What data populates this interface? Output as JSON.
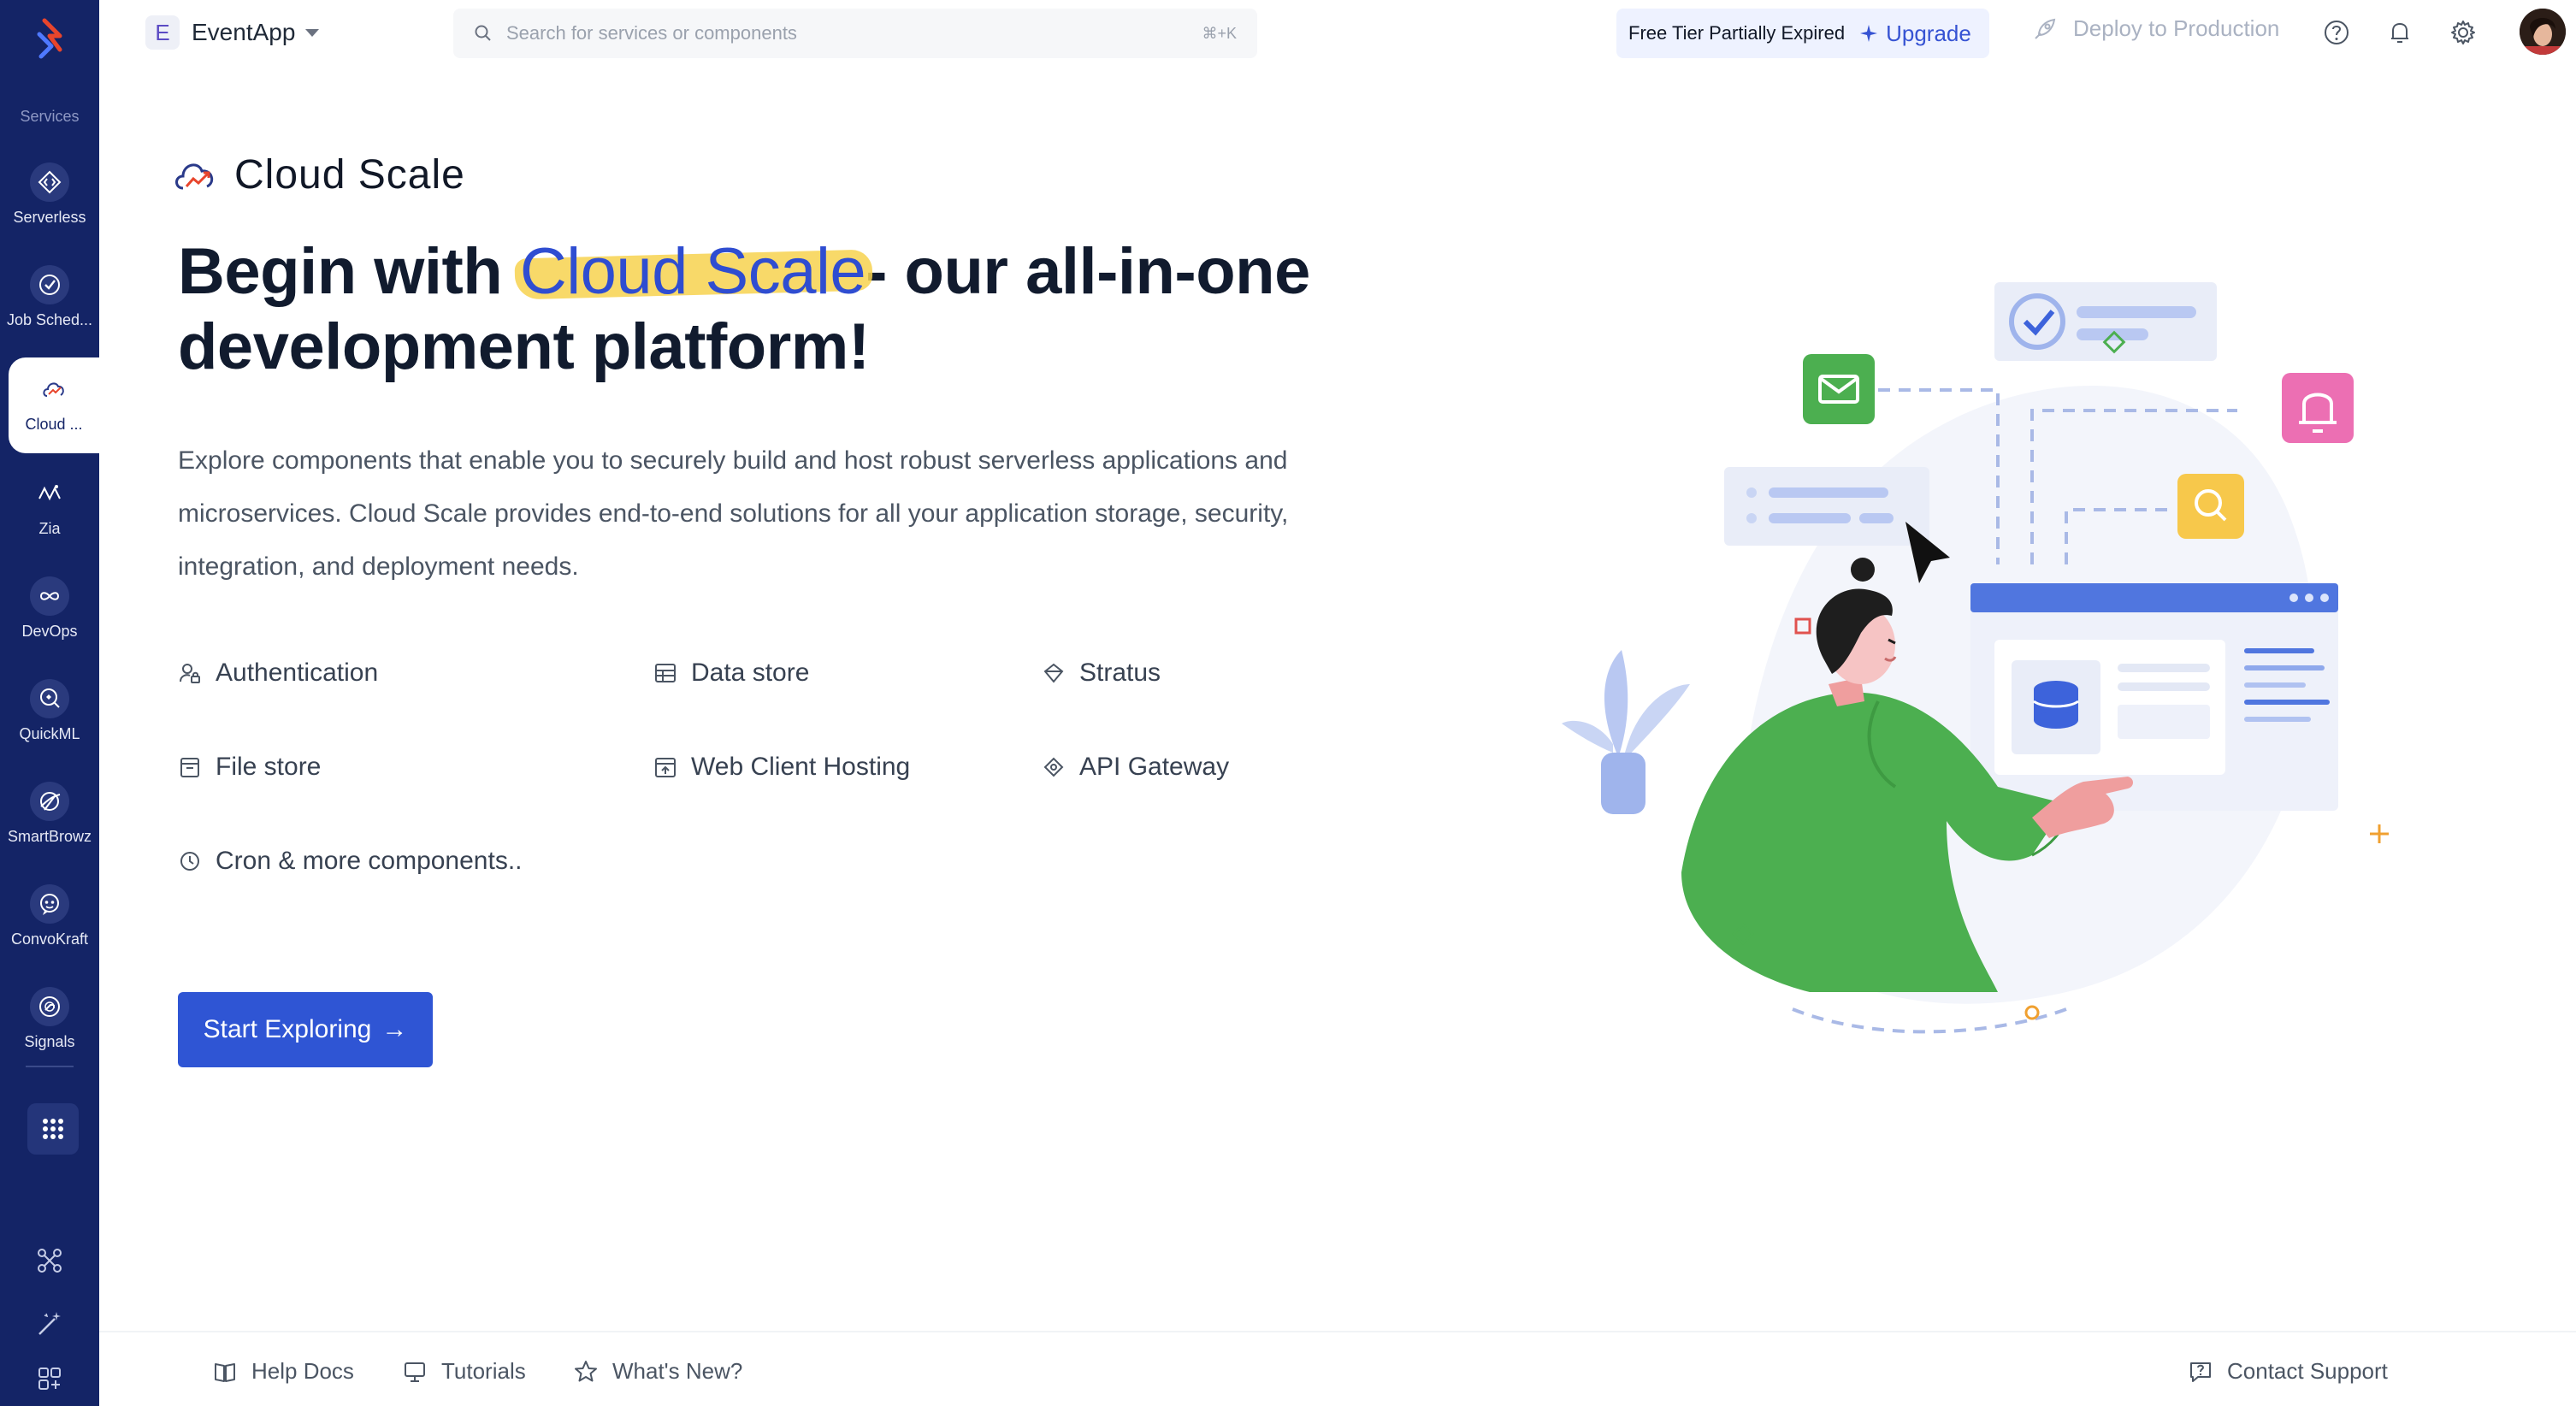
{
  "sidebar": {
    "section_label": "Services",
    "items": [
      {
        "label": "Serverless",
        "icon": "code-brackets-icon"
      },
      {
        "label": "Job Sched...",
        "icon": "clock-check-icon"
      },
      {
        "label": "Cloud ...",
        "icon": "cloud-scale-icon",
        "active": true
      },
      {
        "label": "Zia",
        "icon": "zia-icon"
      },
      {
        "label": "DevOps",
        "icon": "infinity-icon"
      },
      {
        "label": "QuickML",
        "icon": "ml-bulb-icon"
      },
      {
        "label": "SmartBrowz",
        "icon": "browser-globe-icon"
      },
      {
        "label": "ConvoKraft",
        "icon": "chat-bot-icon"
      },
      {
        "label": "Signals",
        "icon": "signal-icon"
      }
    ]
  },
  "topbar": {
    "project_initial": "E",
    "project_name": "EventApp",
    "search_placeholder": "Search for services or components",
    "search_shortcut": "⌘+K",
    "tier_text": "Free Tier Partially Expired",
    "upgrade_label": "Upgrade",
    "deploy_label": "Deploy to Production"
  },
  "hero": {
    "product_name": "Cloud Scale",
    "headline_prefix": "Begin with ",
    "headline_highlight": "Cloud Scale",
    "headline_suffix": "- our all-in-one development platform!",
    "description": "Explore components that enable you to securely build and host robust serverless applications and microservices. Cloud Scale provides end-to-end solutions for all your application storage, security, integration, and deployment needs.",
    "features": [
      {
        "label": "Authentication",
        "icon": "user-lock-icon"
      },
      {
        "label": "Data store",
        "icon": "database-table-icon"
      },
      {
        "label": "Stratus",
        "icon": "bucket-icon"
      },
      {
        "label": "File store",
        "icon": "folder-icon"
      },
      {
        "label": "Web Client Hosting",
        "icon": "web-hosting-icon"
      },
      {
        "label": "API Gateway",
        "icon": "api-gateway-icon"
      },
      {
        "label": "Cron & more components..",
        "icon": "clock-icon"
      }
    ],
    "cta_label": "Start Exploring",
    "cta_arrow": "→"
  },
  "footer": {
    "help_docs": "Help Docs",
    "tutorials": "Tutorials",
    "whats_new": "What's New?",
    "contact_support": "Contact Support"
  },
  "colors": {
    "sidebar_bg": "#142466",
    "accent": "#2f55d4",
    "highlight": "#f7d24f",
    "illustration_green": "#4caf50",
    "illustration_pink": "#ec6fb3",
    "illustration_yellow": "#f7c84b"
  }
}
